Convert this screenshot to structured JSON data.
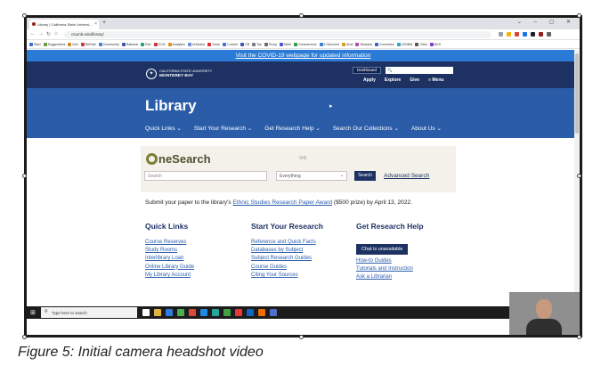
{
  "browser": {
    "tab_title": "Library | California State Universi...",
    "tab_close": "×",
    "new_tab": "+",
    "window_controls": "⌄ – ▢ ✕",
    "url": "csumb.edu/library/",
    "bookmarks": [
      {
        "label": "Start",
        "color": "#3b6fd3"
      },
      {
        "label": "Suggestions",
        "color": "#6a9a3f"
      },
      {
        "label": "Dell",
        "color": "#d08a21"
      },
      {
        "label": "ReRdst",
        "color": "#c23a3a"
      },
      {
        "label": "Community",
        "color": "#4a7fcf"
      },
      {
        "label": "Rational",
        "color": "#3958a8"
      },
      {
        "label": "Part",
        "color": "#28a06b"
      },
      {
        "label": "GCN",
        "color": "#d2333a"
      },
      {
        "label": "Analytics",
        "color": "#e08e1c"
      },
      {
        "label": "UnNuted",
        "color": "#6b8bd8"
      },
      {
        "label": "Youtu",
        "color": "#e02b2b"
      },
      {
        "label": "Current",
        "color": "#4671c6"
      },
      {
        "label": "CB",
        "color": "#3b55b1"
      },
      {
        "label": "Tsp",
        "color": "#7a7a7a"
      },
      {
        "label": "Proxy",
        "color": "#6a6a6a"
      },
      {
        "label": "Mark",
        "color": "#4a55c7"
      },
      {
        "label": "Consciences",
        "color": "#2d9d4a"
      },
      {
        "label": "It Outcome",
        "color": "#3f7bd0"
      },
      {
        "label": "Ame",
        "color": "#d6a01d"
      },
      {
        "label": "Meadow",
        "color": "#b14bb3"
      },
      {
        "label": "Connector",
        "color": "#3a64c8"
      },
      {
        "label": "LEDBIA",
        "color": "#3aa0c0"
      },
      {
        "label": "Cites",
        "color": "#555555"
      },
      {
        "label": "NKS",
        "color": "#7b3fd0"
      }
    ],
    "extension_colors": [
      "#9aa0a6",
      "#f4b400",
      "#db4437",
      "#1a73e8",
      "#202124",
      "#9b1c1c",
      "#5f6368"
    ]
  },
  "page": {
    "covid_banner": "Visit the COVID-19 webpage for updated information",
    "logo_line1": "CALIFORNIA STATE UNIVERSITY",
    "logo_line2": "MONTEREY BAY",
    "dashboard_label": "Dashboard",
    "site_search_icon": "🔍",
    "site_nav": [
      "Apply",
      "Explore",
      "Give",
      "≡ Menu"
    ],
    "library_title": "Library",
    "cursor": "▸",
    "library_tabs": [
      "Quick Links ⌄",
      "Start Your Research ⌄",
      "Get Research Help ⌄",
      "Search Our Collections ⌄",
      "About Us ⌄"
    ],
    "onesearch": {
      "logo_rest": "neSearch",
      "dots": "○○",
      "placeholder": "Search",
      "select_value": "Everything",
      "select_chevron": "⌄",
      "button": "Search",
      "advanced": "Advanced Search"
    },
    "submit_prefix": "Submit your paper to the library's ",
    "submit_link": "Ethnic Studies Research Paper Award",
    "submit_suffix": " ($500 prize) by April 13, 2022.",
    "quick_links": {
      "heading": "Quick Links",
      "items": [
        "Course Reserves",
        "Study Rooms",
        "Interlibrary Loan",
        "Online Library Guide",
        "My Library Account"
      ]
    },
    "start_research": {
      "heading": "Start Your Research",
      "items": [
        "Reference and Quick Facts",
        "Databases by Subject",
        "Subject Research Guides",
        "Course Guides",
        "Citing Your Sources"
      ]
    },
    "research_help": {
      "heading": "Get Research Help",
      "chat_button": "Chat is unavailable",
      "items": [
        "How-to Guides",
        "Tutorials and Instruction",
        "Ask a Librarian"
      ]
    }
  },
  "taskbar": {
    "start": "⊞",
    "search_icon": "⚲",
    "search_placeholder": "Type here to search",
    "icon_colors": [
      "#ffffff",
      "#e3b341",
      "#2f7be0",
      "#4caf50",
      "#d84b3c",
      "#1e88e5",
      "#26a69a",
      "#43a047",
      "#e53935",
      "#1565c0",
      "#ef6c00",
      "#4f6ec7"
    ]
  },
  "caption": "Figure 5: Initial camera headshot video"
}
